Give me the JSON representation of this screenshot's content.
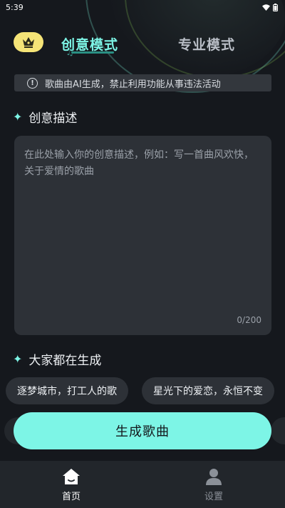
{
  "status_bar": {
    "time": "5:39"
  },
  "header": {
    "tab_creative": "创意模式",
    "tab_pro": "专业模式",
    "badge_icon": "crown-icon"
  },
  "notice": {
    "icon": "info-icon",
    "text": "歌曲由AI生成，禁止利用功能从事违法活动"
  },
  "description": {
    "title": "创意描述",
    "placeholder": "在此处输入你的创意描述，例如：写一首曲风欢快，关于爱情的歌曲",
    "value": "",
    "counter": "0/200"
  },
  "trending": {
    "title": "大家都在生成",
    "chips": [
      "逐梦城市，打工人的歌",
      "星光下的爱恋，永恒不变"
    ]
  },
  "generate_button": {
    "label": "生成歌曲"
  },
  "bottom_nav": {
    "items": [
      {
        "label": "首页",
        "icon": "home-icon",
        "active": true
      },
      {
        "label": "设置",
        "icon": "user-icon",
        "active": false
      }
    ]
  },
  "colors": {
    "accent": "#7df5e6",
    "badge": "#f5e477",
    "background": "#15181d",
    "card": "#2d3137"
  }
}
